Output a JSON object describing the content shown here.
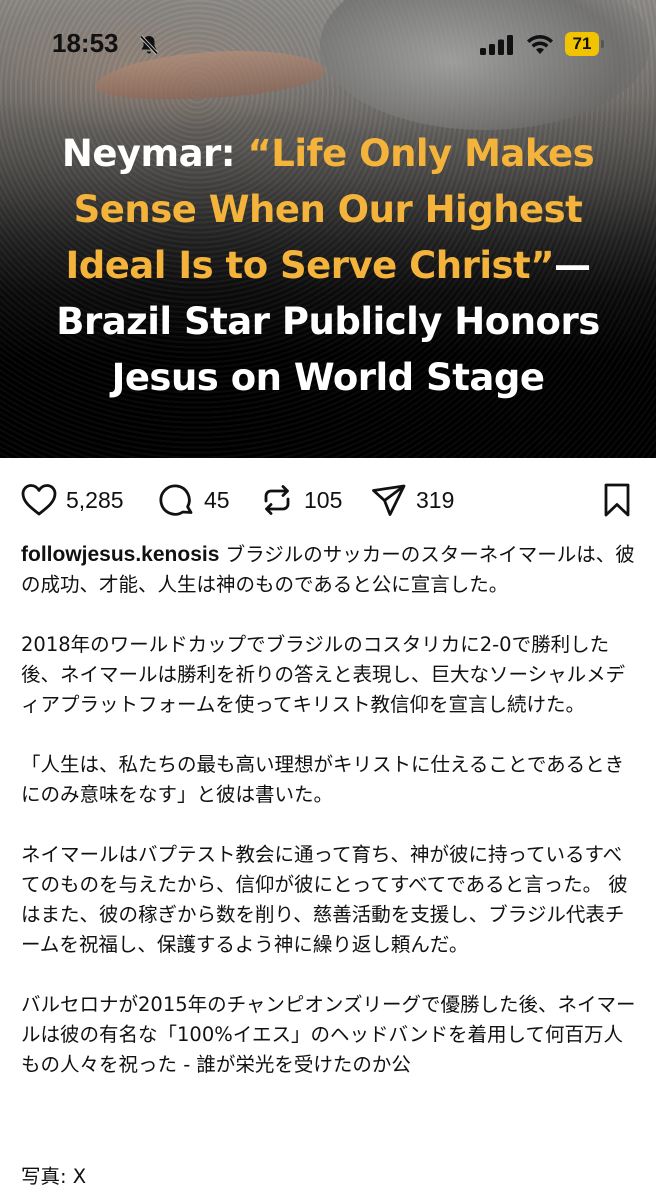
{
  "status_bar": {
    "time": "18:53",
    "battery": "71"
  },
  "hero": {
    "headline_white_1": "Neymar: ",
    "headline_gold": "“Life Only Makes Sense When Our Highest Ideal Is to Serve Christ”",
    "headline_white_2": "— Brazil Star Publicly Honors Jesus on World Stage"
  },
  "actions": {
    "likes": "5,285",
    "comments": "45",
    "reposts": "105",
    "shares": "319"
  },
  "caption": {
    "username": "followjesus.kenosis",
    "p1": " ブラジルのサッカーのスターネイマールは、彼の成功、才能、人生は神のものであると公に宣言した。",
    "p2": "2018年のワールドカップでブラジルのコスタリカに2-0で勝利した後、ネイマールは勝利を祈りの答えと表現し、巨大なソーシャルメディアプラットフォームを使ってキリスト教信仰を宣言し続けた。",
    "p3": "「人生は、私たちの最も高い理想がキリストに仕えることであるときにのみ意味をなす」と彼は書いた。",
    "p4": "ネイマールはバプテスト教会に通って育ち、神が彼に持っているすべてのものを与えたから、信仰が彼にとってすべてであると言った。 彼はまた、彼の稼ぎから数を削り、慈善活動を支援し、ブラジル代表チームを祝福し、保護するよう神に繰り返し頼んだ。",
    "p5": "バルセロナが2015年のチャンピオンズリーグで優勝した後、ネイマールは彼の有名な「100%イエス」のヘッドバンドを着用して何百万人もの人々を祝った - 誰が栄光を受けたのか公",
    "photo_credit": "写真: X"
  },
  "colors": {
    "headline_gold": "#f4b43c",
    "battery": "#f2c400"
  },
  "icons": [
    "bell-slash-icon",
    "signal-icon",
    "wifi-icon",
    "heart-icon",
    "comment-icon",
    "repost-icon",
    "share-icon",
    "bookmark-icon"
  ]
}
